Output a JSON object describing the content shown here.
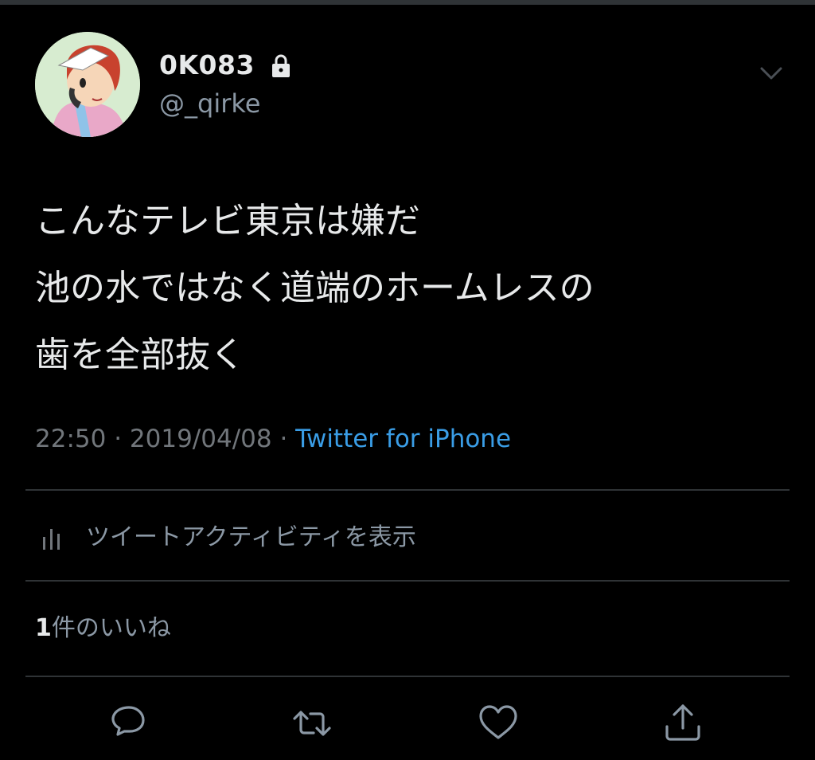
{
  "user": {
    "display_name": "0K083",
    "handle": "@_qirke",
    "protected_icon": "lock-icon",
    "menu_icon": "chevron-down-icon"
  },
  "tweet": {
    "text": "こんなテレビ東京は嫌だ\n池の水ではなく道端のホームレスの\n歯を全部抜く",
    "time": "22:50",
    "separator": " · ",
    "date": "2019/04/08",
    "source": "Twitter for iPhone"
  },
  "activity": {
    "icon": "bar-chart-icon",
    "label": "ツイートアクティビティを表示"
  },
  "likes": {
    "count": "1",
    "label": "件のいいね"
  },
  "actions": {
    "reply_icon": "reply-icon",
    "retweet_icon": "retweet-icon",
    "like_icon": "heart-icon",
    "share_icon": "share-icon"
  },
  "colors": {
    "background": "#000000",
    "text": "#e7e9ea",
    "secondary": "#71767b",
    "link": "#3a9de6",
    "divider": "#2f3336"
  }
}
